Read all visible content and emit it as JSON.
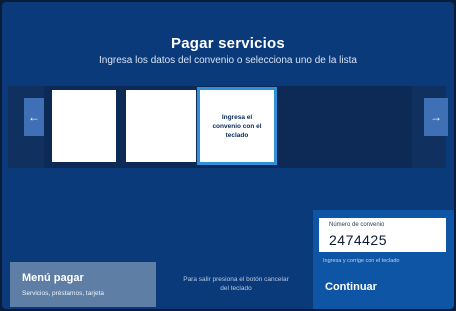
{
  "header": {
    "title": "Pagar servicios",
    "subtitle": "Ingresa los datos del convenio o selecciona uno de la lista"
  },
  "carousel": {
    "prev_icon": "arrow-left-icon",
    "next_icon": "arrow-right-icon",
    "prev_glyph": "←",
    "next_glyph": "→",
    "keyboard_card_label": "Ingresa el convenio con el teclado"
  },
  "menu": {
    "title": "Menú pagar",
    "subtitle": "Servicios, préstamos, tarjeta"
  },
  "hint": {
    "text": "Para salir presiona el botón cancelar del teclado"
  },
  "convenio": {
    "label": "Número de convenio",
    "value": "2474425",
    "helper": "Ingresa y corrige con el teclado",
    "continue_label": "Continuar"
  },
  "colors": {
    "background": "#0a3a7a",
    "panel": "#0f55a6",
    "nav_button": "#3f6fb5",
    "menu_button": "#5f7ea6",
    "selected_outline": "#2f8fd8"
  }
}
